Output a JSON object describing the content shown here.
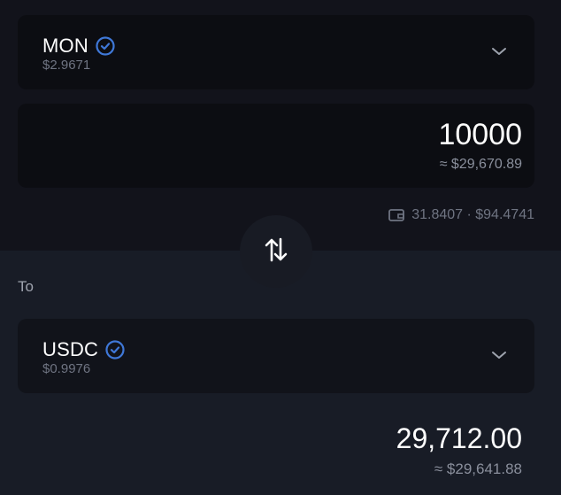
{
  "from": {
    "token_symbol": "MON",
    "token_price": "$2.9671",
    "amount": "10000",
    "amount_usd": "≈ $29,670.89",
    "balance": "31.8407 · $94.4741"
  },
  "to": {
    "label": "To",
    "token_symbol": "USDC",
    "token_price": "$0.9976",
    "amount": "29,712.00",
    "amount_usd": "≈ $29,641.88"
  },
  "icons": {
    "verified": "verified-check-icon",
    "chevron": "chevron-down-icon",
    "wallet": "wallet-icon",
    "swap": "swap-arrows-icon"
  },
  "colors": {
    "verified_accent": "#3f78d8",
    "top_background": "#12131b",
    "bottom_background": "#181c26"
  }
}
